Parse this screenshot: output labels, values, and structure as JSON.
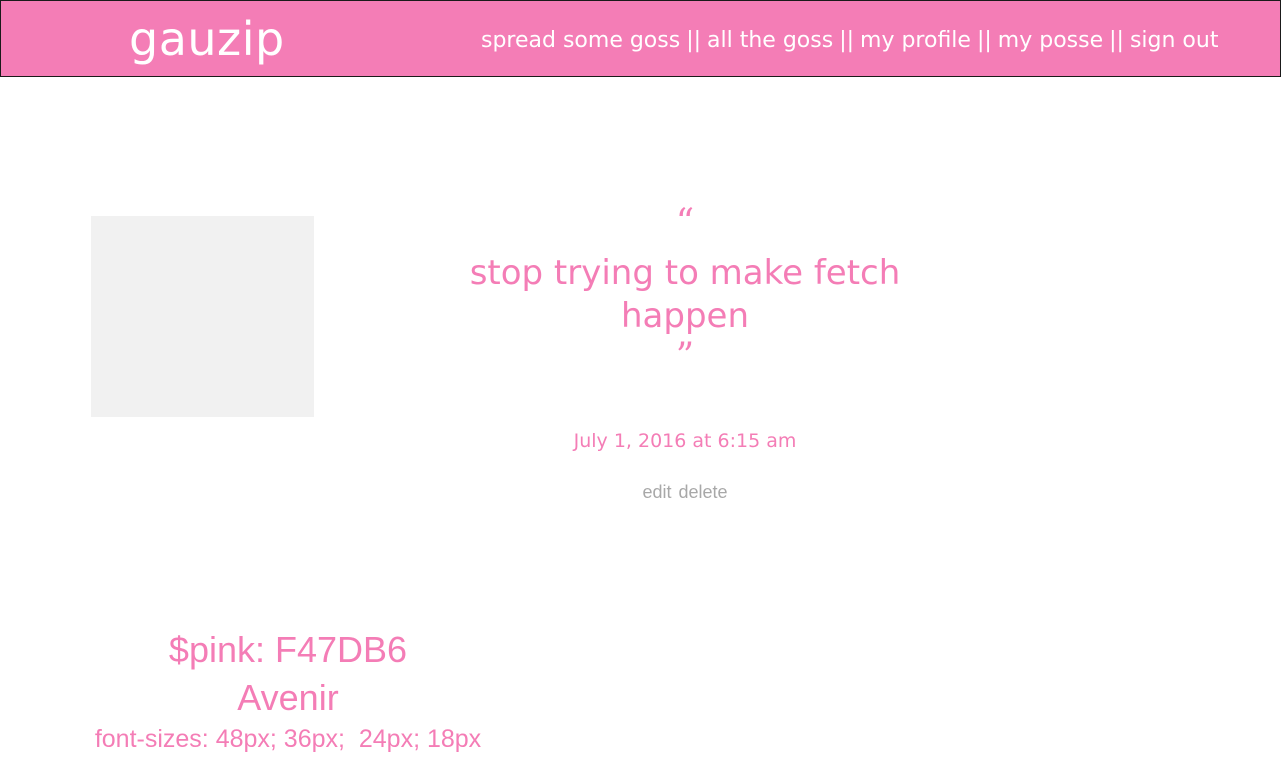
{
  "header": {
    "logo": "gauzip",
    "nav": [
      {
        "label": "spread some goss"
      },
      {
        "label": "all the goss"
      },
      {
        "label": "my profile"
      },
      {
        "label": "my posse"
      },
      {
        "label": "sign out"
      }
    ],
    "separator": "||"
  },
  "post": {
    "open_quote": "“",
    "text": "stop trying to make fetch happen",
    "close_quote": "”",
    "timestamp": "July 1, 2016 at 6:15 am",
    "edit_label": "edit",
    "delete_label": "delete"
  },
  "style_notes": {
    "color": "$pink: F47DB6",
    "font": "Avenir",
    "sizes": "font-sizes: 48px; 36px;  24px; 18px"
  },
  "colors": {
    "pink": "#F47DB6",
    "placeholder": "#f1f1f1",
    "muted": "#a8a8a8"
  }
}
